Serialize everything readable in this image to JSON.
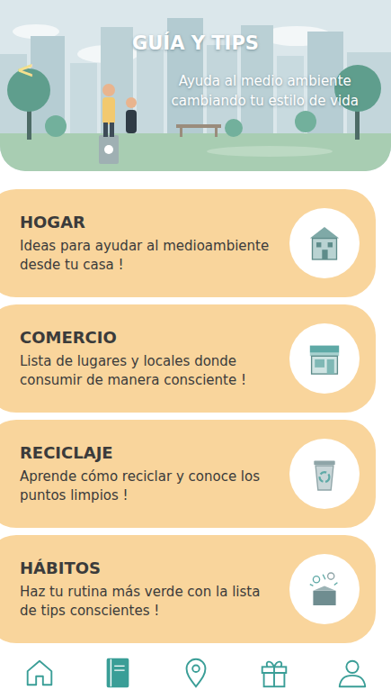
{
  "header": {
    "back": "<",
    "title": "GUÍA Y TIPS",
    "subtitle": [
      "Ayuda al medio ambiente",
      "cambiando tu estilo de vida"
    ]
  },
  "sections": [
    {
      "title": "HOGAR",
      "description": "Ideas para ayudar al medioambiente desde tu casa !"
    },
    {
      "title": "COMERCIO",
      "description": "Lista de lugares y locales donde consumir de manera consciente !"
    },
    {
      "title": "RECICLAJE",
      "description": "Aprende cómo reciclar y conoce los puntos limpios !"
    },
    {
      "title": "HÁBITOS",
      "description": "Haz tu rutina más verde con la lista de tips conscientes !"
    }
  ],
  "nav": [
    {
      "selected": false
    },
    {
      "selected": true
    },
    {
      "selected": false
    },
    {
      "selected": false
    },
    {
      "selected": false
    }
  ]
}
